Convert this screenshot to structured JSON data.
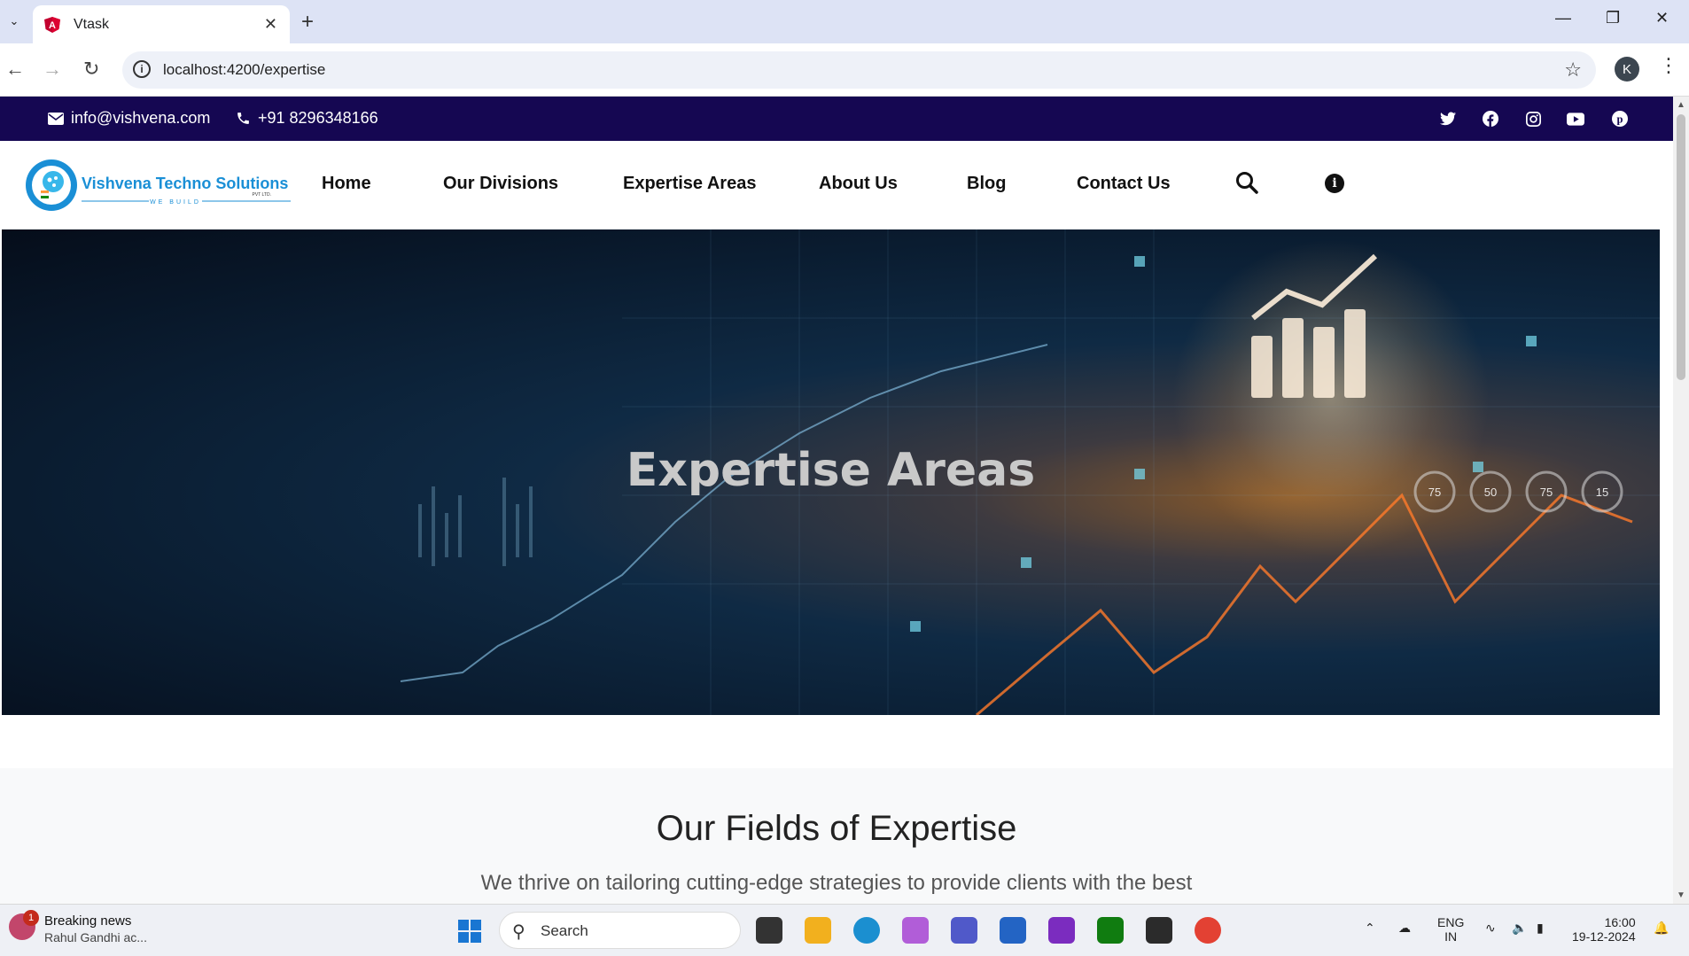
{
  "browser": {
    "tab_title": "Vtask",
    "url": "localhost:4200/expertise",
    "profile_initial": "K"
  },
  "topbar": {
    "email": "info@vishvena.com",
    "phone": "+91 8296348166",
    "socials": [
      "twitter-icon",
      "facebook-icon",
      "instagram-icon",
      "youtube-icon",
      "pinterest-icon"
    ],
    "bg_color": "#150752"
  },
  "logo": {
    "name": "Vishvena Techno Solutions",
    "suffix": "PVT LTD.",
    "tagline": "WE BUILD"
  },
  "nav": {
    "items": [
      "Home",
      "Our Divisions",
      "Expertise Areas",
      "About Us",
      "Blog",
      "Contact Us"
    ]
  },
  "hero": {
    "title": "Expertise Areas"
  },
  "section": {
    "heading": "Our Fields of Expertise",
    "text": "We thrive on tailoring cutting-edge strategies to provide clients with the best"
  },
  "taskbar": {
    "news_title": "Breaking news",
    "news_sub": "Rahul Gandhi ac...",
    "news_badge": "1",
    "search_label": "Search",
    "lang_top": "ENG",
    "lang_bottom": "IN",
    "time": "16:00",
    "date": "19-12-2024"
  }
}
